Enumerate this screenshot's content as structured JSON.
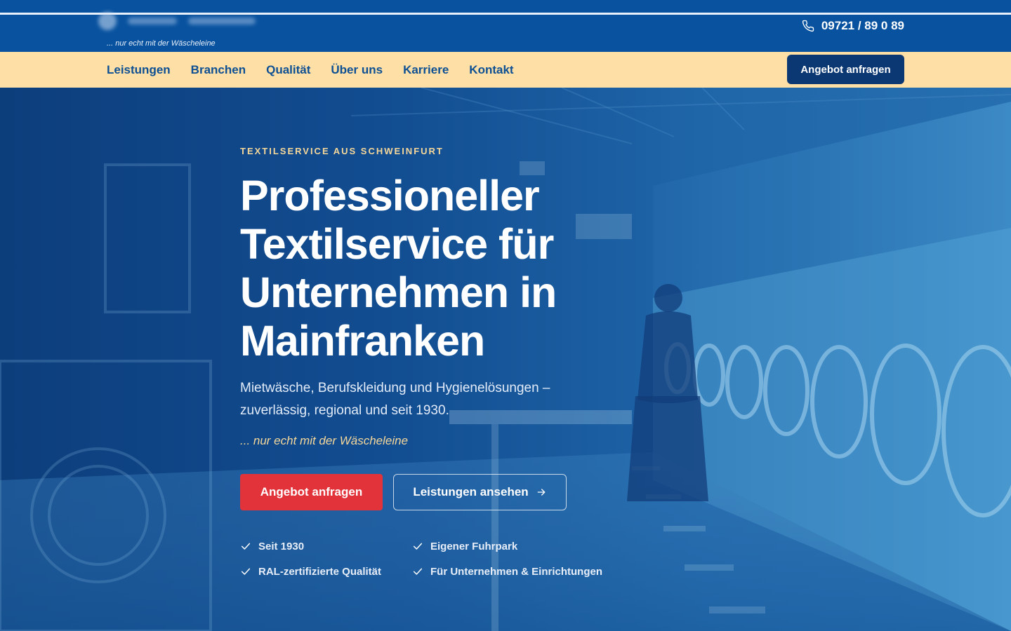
{
  "topbar": {
    "slogan": "... nur echt mit der Wäscheleine",
    "phone": "09721 / 89 0 89",
    "phone_icon": "phone-icon"
  },
  "nav": {
    "items": [
      "Leistungen",
      "Branchen",
      "Qualität",
      "Über uns",
      "Karriere",
      "Kontakt"
    ],
    "cta_label": "Angebot anfragen"
  },
  "hero": {
    "eyebrow": "TEXTILSERVICE AUS SCHWEINFURT",
    "headline": "Professioneller Textilservice für Unternehmen in Mainfranken",
    "lead": "Mietwäsche, Berufskleidung und Hygienelösungen – zuverlässig, regional und seit 1930.",
    "tagline": "... nur echt mit der Wäscheleine",
    "primary_label": "Angebot anfragen",
    "secondary_label": "Leistungen ansehen",
    "secondary_icon": "arrow-right-icon",
    "features": [
      "Seit 1930",
      "Eigener Fuhrpark",
      "RAL-zertifizierte Qualität",
      "Für Unternehmen & Einrichtungen"
    ],
    "feature_icon": "check-icon"
  },
  "colors": {
    "topbar_bg": "#08529f",
    "nav_bg": "#fedfa6",
    "nav_text": "#0d4f93",
    "cta_bg": "#0b3772",
    "accent_red": "#e2323a",
    "accent_gold": "#f5d79a"
  }
}
